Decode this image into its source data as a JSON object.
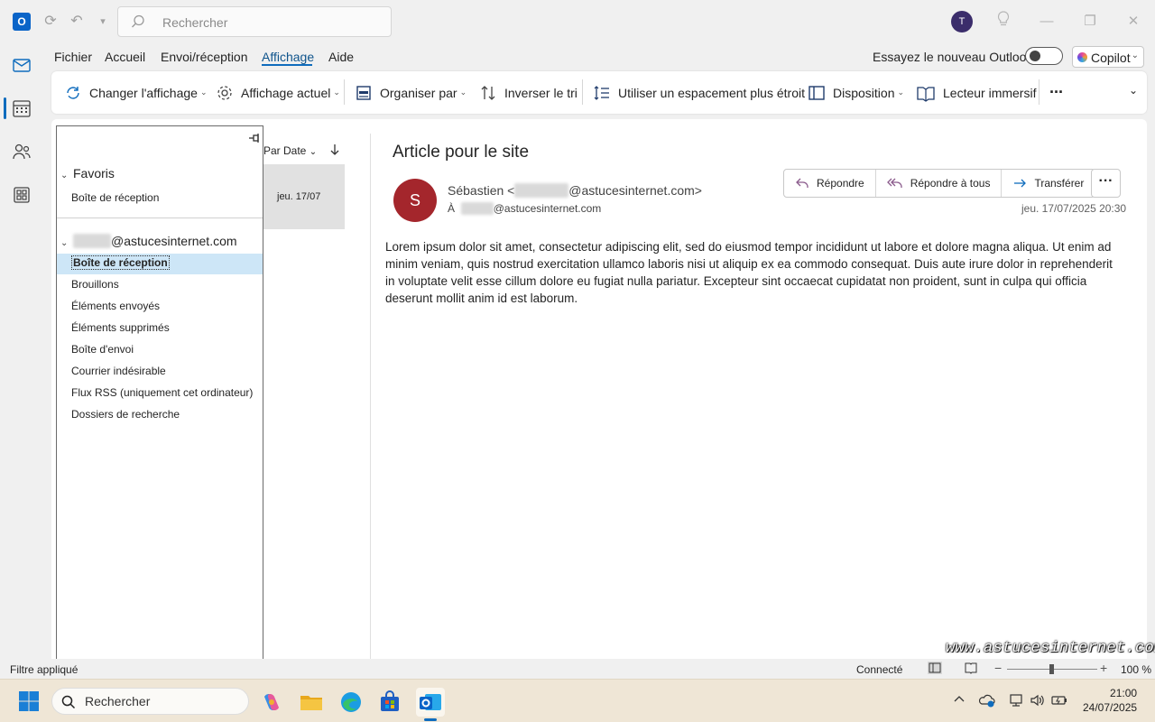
{
  "titlebar": {
    "app_letter": "O",
    "search_placeholder": "Rechercher",
    "user_initial": "T"
  },
  "menu": {
    "items": [
      "Fichier",
      "Accueil",
      "Envoi/réception",
      "Affichage",
      "Aide"
    ],
    "active": "Affichage",
    "try_new_outlook": "Essayez le nouveau Outlook",
    "copilot": "Copilot"
  },
  "ribbon": {
    "change_view": "Changer l'affichage",
    "current_view": "Affichage actuel",
    "arrange_by": "Organiser par",
    "reverse_sort": "Inverser le tri",
    "compact": "Utiliser un espacement plus étroit",
    "layout": "Disposition",
    "immersive_reader": "Lecteur immersif",
    "more": "···"
  },
  "folders": {
    "favorites_label": "Favoris",
    "favorites_items": [
      "Boîte de réception"
    ],
    "account_hidden": "tutoriel",
    "account_domain": "@astucesinternet.com",
    "items": [
      "Boîte de réception",
      "Brouillons",
      "Éléments envoyés",
      "Éléments supprimés",
      "Boîte d'envoi",
      "Courrier indésirable",
      "Flux RSS (uniquement cet ordinateur)",
      "Dossiers de recherche"
    ],
    "selected": "Boîte de réception"
  },
  "message_list": {
    "sort_label": "Par Date",
    "rows": [
      {
        "date": "jeu. 17/07"
      }
    ]
  },
  "message": {
    "subject": "Article pour le site",
    "sender_initial": "S",
    "sender_name": "Sébastien <",
    "sender_hidden": "sebastien",
    "sender_domain": "@astucesinternet.com>",
    "to_label": "À",
    "to_hidden": "tutoriel",
    "to_domain": "@astucesinternet.com",
    "reply": "Répondre",
    "reply_all": "Répondre à tous",
    "forward": "Transférer",
    "date": "jeu. 17/07/2025 20:30",
    "body": "Lorem ipsum dolor sit amet, consectetur adipiscing elit, sed do eiusmod tempor incididunt ut labore et dolore magna aliqua. Ut enim ad minim veniam, quis nostrud exercitation ullamco laboris nisi ut aliquip ex ea commodo consequat. Duis aute irure dolor in reprehenderit in voluptate velit esse cillum dolore eu fugiat nulla pariatur. Excepteur sint occaecat cupidatat non proident, sunt in culpa qui officia deserunt mollit anim id est laborum."
  },
  "watermark": "www.astucesinternet.com",
  "statusbar": {
    "filter": "Filtre appliqué",
    "connection": "Connecté",
    "zoom": "100 %",
    "zoom_level": 0.5
  },
  "taskbar": {
    "search_placeholder": "Rechercher",
    "time": "21:00",
    "date": "24/07/2025"
  },
  "colors": {
    "accent": "#0f6cbd",
    "sender_avatar": "#a4262c",
    "user_avatar": "#3b2d6b",
    "selection": "#cde6f7"
  }
}
